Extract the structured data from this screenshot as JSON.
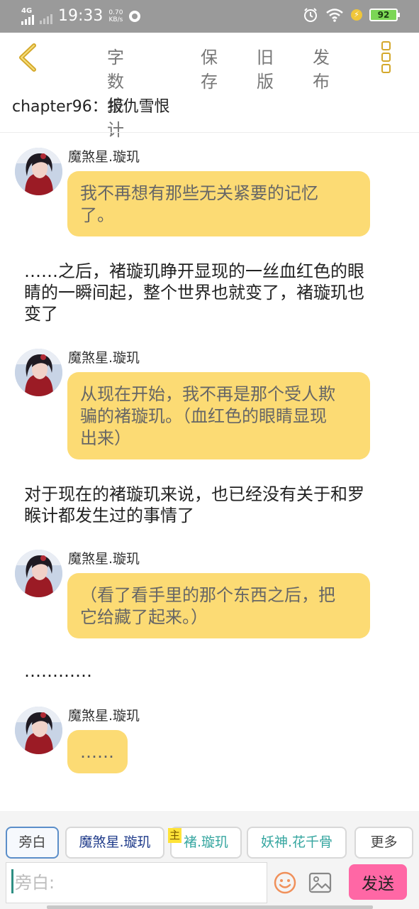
{
  "status_bar": {
    "network": "4G",
    "time": "19:33",
    "speed_value": "0.70",
    "speed_unit": "KB/s",
    "battery": "92",
    "icons": [
      "signal-icon",
      "alarm-icon",
      "wifi-icon",
      "charging-icon",
      "battery-icon"
    ]
  },
  "toolbar": {
    "back_icon": "chevron-left-icon",
    "items": [
      "字数统计",
      "保存",
      "旧版",
      "发布"
    ],
    "more_icon": "more-vertical-icon",
    "accent": "#d4a82b"
  },
  "chapter": {
    "title": "chapter96：报仇雪恨"
  },
  "messages": [
    {
      "speaker": "魔煞星.璇玑",
      "text_lines": [
        "我不再想有那些无关紧要的记忆",
        "了。"
      ]
    },
    {
      "narration_lines": [
        "……之后，褚璇玑睁开显现的一丝血红色的眼",
        "睛的一瞬间起，整个世界也就变了，褚璇玑也",
        "变了"
      ]
    },
    {
      "speaker": "魔煞星.璇玑",
      "text_lines": [
        "从现在开始，我不再是那个受人欺",
        "骗的褚璇玑。（血红色的眼睛显现",
        "出来）"
      ]
    },
    {
      "narration_lines": [
        "对于现在的褚璇玑来说，也已经没有关于和罗",
        "睺计都发生过的事情了"
      ]
    },
    {
      "speaker": "魔煞星.璇玑",
      "text_lines": [
        "（看了看手里的那个东西之后，把",
        "它给藏了起来。）"
      ]
    },
    {
      "narration_lines": [
        "…………"
      ]
    },
    {
      "speaker": "魔煞星.璇玑",
      "text_lines": [
        "……"
      ]
    }
  ],
  "roles": {
    "items": [
      "旁白",
      "魔煞星.璇玑",
      "褚.璇玑",
      "妖神.花千骨",
      "更多"
    ],
    "main_tag": "主",
    "selected": "旁白"
  },
  "composer": {
    "placeholder": "旁白:",
    "send_label": "发送",
    "emoji_icon": "emoji-smile-icon",
    "image_icon": "image-icon",
    "send_color": "#ff67a5"
  },
  "colors": {
    "bubble": "#fcdb74",
    "status_bar": "#9a9a9a"
  }
}
